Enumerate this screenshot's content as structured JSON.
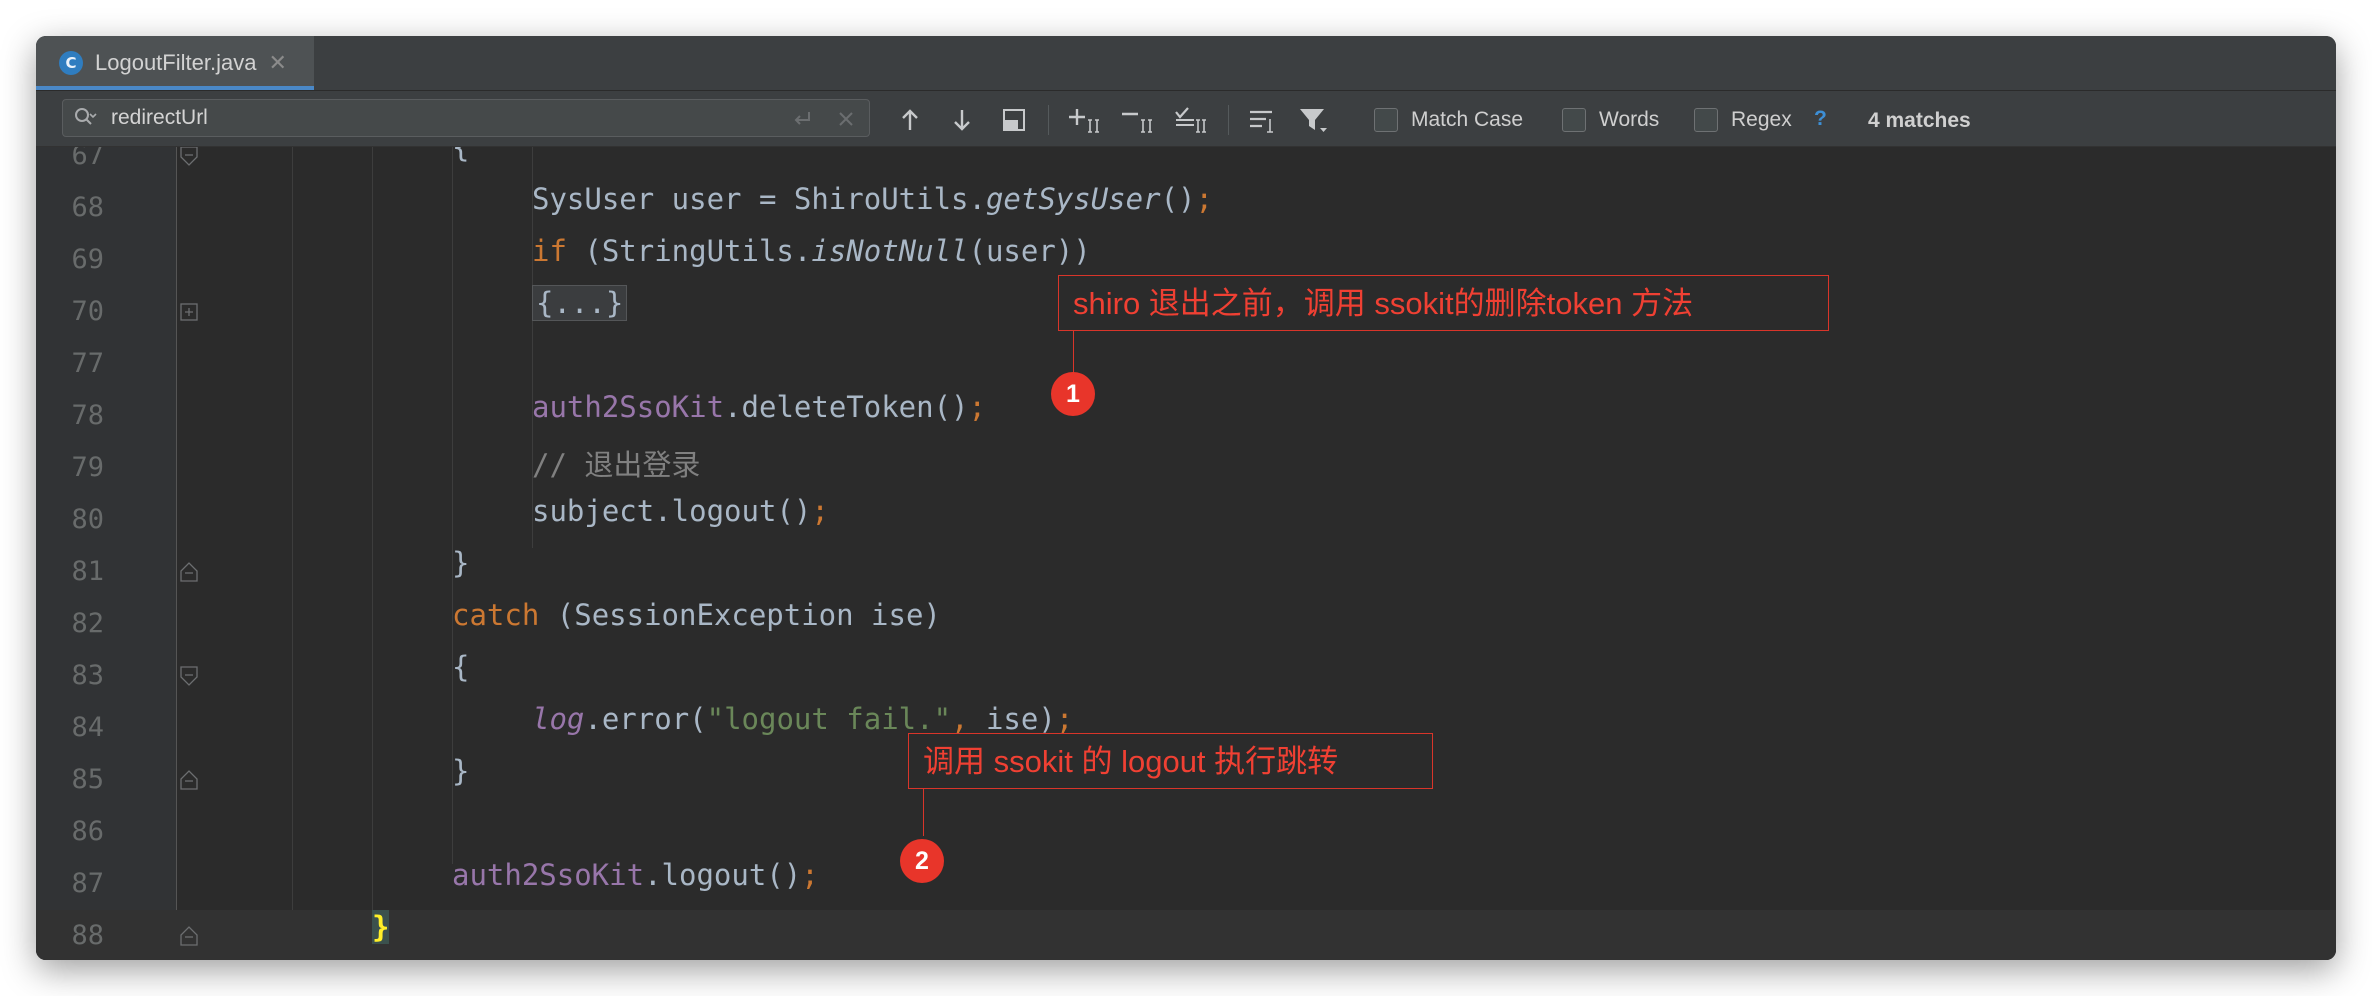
{
  "tab": {
    "icon_letter": "C",
    "filename": "LogoutFilter.java",
    "close_glyph": "✕"
  },
  "search": {
    "value": "redirectUrl",
    "options": [
      {
        "label": "Match Case",
        "checked": false
      },
      {
        "label": "Words",
        "checked": false
      },
      {
        "label": "Regex",
        "checked": false
      }
    ],
    "help": "?",
    "matches": "4 matches"
  },
  "toolbar_icons": [
    "previous-occurrence-icon",
    "next-occurrence-icon",
    "select-all-occurrences-icon",
    "add-selection-icon",
    "remove-selection-icon",
    "select-all-checked-icon",
    "filter-lines-icon",
    "filter-icon"
  ],
  "editor": {
    "lines": [
      {
        "number": "67",
        "code": "{"
      },
      {
        "number": "68",
        "code": "SysUser user = ShiroUtils.getSysUser();"
      },
      {
        "number": "69",
        "code": "if (StringUtils.isNotNull(user))"
      },
      {
        "number": "70",
        "code": "{...}"
      },
      {
        "number": "77",
        "code": ""
      },
      {
        "number": "78",
        "code": "auth2SsoKit.deleteToken();"
      },
      {
        "number": "79",
        "code": "// 退出登录"
      },
      {
        "number": "80",
        "code": "subject.logout();"
      },
      {
        "number": "81",
        "code": "}"
      },
      {
        "number": "82",
        "code": "catch (SessionException ise)"
      },
      {
        "number": "83",
        "code": "{"
      },
      {
        "number": "84",
        "code": "log.error(\"logout fail.\", ise);"
      },
      {
        "number": "85",
        "code": "}"
      },
      {
        "number": "86",
        "code": ""
      },
      {
        "number": "87",
        "code": "auth2SsoKit.logout();"
      },
      {
        "number": "88",
        "code": "}"
      }
    ],
    "current_line": "88"
  },
  "annotations": [
    {
      "number": "1",
      "text": "shiro 退出之前，调用 ssokit的删除token 方法"
    },
    {
      "number": "2",
      "text": "调用 ssokit 的 logout 执行跳转"
    }
  ],
  "colors": {
    "keyword": "#cc7832",
    "field": "#9876aa",
    "string": "#6a8759",
    "comment": "#808080",
    "plain": "#a9b7c6",
    "line_number": "#686b6b",
    "annotation": "#e8352a",
    "brace_match": "#ffef28"
  }
}
